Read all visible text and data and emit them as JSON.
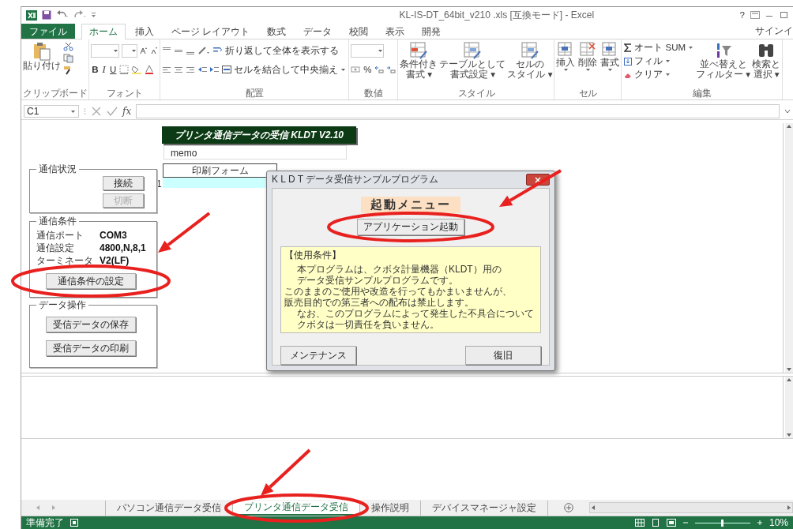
{
  "window": {
    "title": "KL-IS-DT_64bit_v210 .xls  [互換モード] - Excel",
    "help": "?",
    "sign_in": "サインイ"
  },
  "ribbon_tabs": [
    {
      "label": "ファイル",
      "kind": "file",
      "selected": false
    },
    {
      "label": "ホーム",
      "kind": "tab",
      "selected": true
    },
    {
      "label": "挿入",
      "kind": "tab",
      "selected": false
    },
    {
      "label": "ページ レイアウト",
      "kind": "tab",
      "selected": false
    },
    {
      "label": "数式",
      "kind": "tab",
      "selected": false
    },
    {
      "label": "データ",
      "kind": "tab",
      "selected": false
    },
    {
      "label": "校閲",
      "kind": "tab",
      "selected": false
    },
    {
      "label": "表示",
      "kind": "tab",
      "selected": false
    },
    {
      "label": "開発",
      "kind": "tab",
      "selected": false
    }
  ],
  "clipboard": {
    "paste": "貼り付け",
    "label": "クリップボード"
  },
  "font": {
    "style_buttons": [
      "B",
      "I",
      "U"
    ],
    "label": "フォント"
  },
  "alignment": {
    "wrap": "折り返して全体を表示する",
    "merge": "セルを結合して中央揃え",
    "label": "配置"
  },
  "number": {
    "percent": "%",
    "label": "数値"
  },
  "styles": {
    "buttons": [
      {
        "lines": [
          "条件付き",
          "書式 ▾"
        ]
      },
      {
        "lines": [
          "テーブルとして",
          "書式設定 ▾"
        ]
      },
      {
        "lines": [
          "セルの",
          "スタイル ▾"
        ]
      }
    ],
    "label": "スタイル"
  },
  "cells": {
    "buttons": [
      "挿入",
      "削除",
      "書式"
    ],
    "label": "セル"
  },
  "editing": {
    "autosum": "オート SUM",
    "fill": "フィル",
    "clear": "クリア",
    "buttons": [
      {
        "lines": [
          "並べ替えと",
          "フィルター ▾"
        ]
      },
      {
        "lines": [
          "検索と",
          "選択 ▾"
        ]
      }
    ],
    "label": "編集"
  },
  "formula_bar": {
    "name_box": "C1",
    "fx": "fx"
  },
  "sheet": {
    "banner": "プリンタ通信データの受信 KLDT V2.10",
    "memo": "memo",
    "print_form": "印刷フォーム",
    "row_number": "1",
    "status_group": {
      "title": "通信状況",
      "buttons": [
        {
          "label": "接続",
          "disabled": false
        },
        {
          "label": "切断",
          "disabled": true
        }
      ]
    },
    "conditions_group": {
      "title": "通信条件",
      "fields": [
        {
          "label": "通信ポート",
          "value": "COM3"
        },
        {
          "label": "通信設定",
          "value": "4800,N,8,1"
        },
        {
          "label": "ターミネータ",
          "value": "V2(LF)"
        }
      ],
      "button": "通信条件の設定"
    },
    "data_group": {
      "title": "データ操作",
      "buttons": [
        "受信データの保存",
        "受信データの印刷"
      ]
    }
  },
  "dialog": {
    "title": "K L D T データ受信サンプルプログラム",
    "heading": "起動メニュー",
    "launch_button": "アプリケーション起動",
    "notice_title": "【使用条件】",
    "notice_lines": [
      {
        "text": "本プログラムは、クボタ計量機器（KLDT）用の",
        "indented": true
      },
      {
        "text": "データ受信サンプルプログラムです。",
        "indented": true
      },
      {
        "text": "このままのご使用や改造を行ってもかまいませんが、",
        "indented": false
      },
      {
        "text": "販売目的での第三者への配布は禁止します。",
        "indented": false
      },
      {
        "text": "なお、このプログラムによって発生した不具合について",
        "indented": true
      },
      {
        "text": "クボタは一切責任を負いません。",
        "indented": true
      }
    ],
    "buttons": [
      "メンテナンス",
      "復旧"
    ]
  },
  "sheet_tabs": [
    {
      "label": "パソコン通信データ受信",
      "selected": false
    },
    {
      "label": "プリンタ通信データ受信",
      "selected": true
    },
    {
      "label": "操作説明",
      "selected": false
    },
    {
      "label": "デバイスマネージャ設定",
      "selected": false
    }
  ],
  "status_bar": {
    "status": "準備完了",
    "zoom": "10%",
    "zoom_slider": {
      "level": 0.5
    }
  }
}
